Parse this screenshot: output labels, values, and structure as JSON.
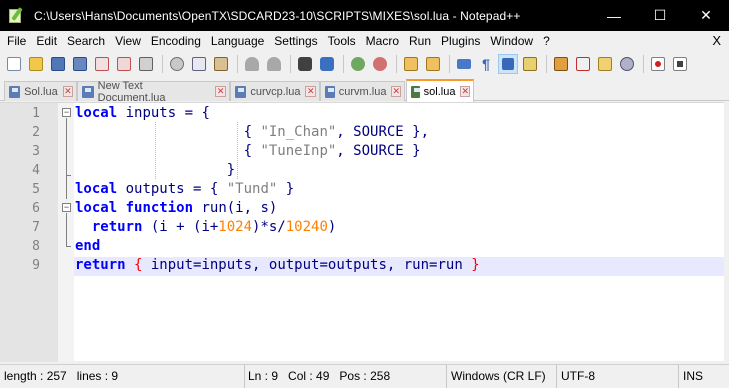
{
  "window": {
    "title": "C:\\Users\\Hans\\Documents\\OpenTX\\SDCARD23-10\\SCRIPTS\\MIXES\\sol.lua - Notepad++",
    "minimize_glyph": "—",
    "maximize_glyph": "☐",
    "close_glyph": "✕"
  },
  "menu": {
    "items": [
      "File",
      "Edit",
      "Search",
      "View",
      "Encoding",
      "Language",
      "Settings",
      "Tools",
      "Macro",
      "Run",
      "Plugins",
      "Window",
      "?"
    ],
    "close_label": "X"
  },
  "toolbar": {
    "icons": [
      "new-file-icon",
      "open-file-icon",
      "save-icon",
      "save-all-icon",
      "close-icon",
      "close-all-icon",
      "print-icon",
      "cut-icon",
      "copy-icon",
      "paste-icon",
      "undo-icon",
      "redo-icon",
      "find-icon",
      "replace-icon",
      "zoom-in-icon",
      "zoom-out-icon",
      "sync-vertical-icon",
      "sync-horizontal-icon",
      "word-wrap-icon",
      "show-all-chars-icon",
      "indent-guide-icon",
      "language-icon",
      "doc-map-icon",
      "function-list-icon",
      "folder-workspace-icon",
      "monitoring-icon",
      "record-macro-icon",
      "stop-macro-icon"
    ]
  },
  "tabs": [
    {
      "label": "Sol.lua",
      "active": false
    },
    {
      "label": "New Text Document.lua",
      "active": false
    },
    {
      "label": "curvcp.lua",
      "active": false
    },
    {
      "label": "curvm.lua",
      "active": false
    },
    {
      "label": "sol.lua",
      "active": true
    }
  ],
  "editor": {
    "line_numbers": [
      "1",
      "2",
      "3",
      "4",
      "5",
      "6",
      "7",
      "8",
      "9"
    ],
    "lines": [
      {
        "parts": [
          [
            "kw",
            "local"
          ],
          [
            "op",
            " inputs = {"
          ]
        ]
      },
      {
        "parts": [
          [
            "op",
            "                    { "
          ],
          [
            "str",
            "\"In_Chan\""
          ],
          [
            "op",
            ", SOURCE },"
          ]
        ]
      },
      {
        "parts": [
          [
            "op",
            "                    { "
          ],
          [
            "str",
            "\"TuneInp\""
          ],
          [
            "op",
            ", SOURCE }"
          ]
        ]
      },
      {
        "parts": [
          [
            "op",
            "                  }"
          ]
        ]
      },
      {
        "parts": [
          [
            "kw",
            "local"
          ],
          [
            "op",
            " outputs = { "
          ],
          [
            "str",
            "\"Tund\""
          ],
          [
            "op",
            " }"
          ]
        ]
      },
      {
        "parts": [
          [
            "kw",
            "local"
          ],
          [
            "op",
            " "
          ],
          [
            "kw",
            "function"
          ],
          [
            "op",
            " run(i, s)"
          ]
        ]
      },
      {
        "parts": [
          [
            "op",
            "  "
          ],
          [
            "kw",
            "return"
          ],
          [
            "op",
            " (i + (i+"
          ],
          [
            "num",
            "1024"
          ],
          [
            "op",
            ")*s/"
          ],
          [
            "num",
            "10240"
          ],
          [
            "op",
            ")"
          ]
        ]
      },
      {
        "parts": [
          [
            "kw",
            "end"
          ]
        ]
      },
      {
        "parts": [
          [
            "kw",
            "return"
          ],
          [
            "op",
            " "
          ],
          [
            "brace-hl",
            "{"
          ],
          [
            "op",
            " input=inputs, output=outputs, run=run "
          ],
          [
            "brace-hl",
            "}"
          ]
        ]
      }
    ],
    "current_line": 9
  },
  "status": {
    "length": "length : 257",
    "lines": "lines : 9",
    "ln": "Ln : 9",
    "col": "Col : 49",
    "pos": "Pos : 258",
    "eol": "Windows (CR LF)",
    "encoding": "UTF-8",
    "mode": "INS"
  },
  "colors": {
    "active_tab_accent": "#fa9a28",
    "keyword": "#0000ff",
    "string": "#808080",
    "number": "#ff8000",
    "brace_highlight": "#ff0000",
    "current_line": "#e8e8ff"
  }
}
